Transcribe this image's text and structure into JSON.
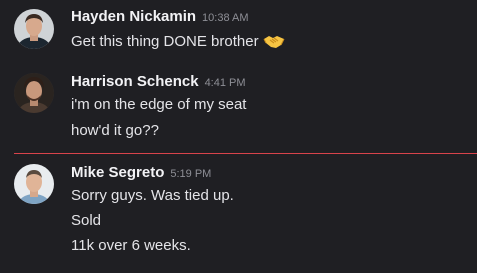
{
  "messages": [
    {
      "author": "Hayden Nickamin",
      "time": "10:38 AM",
      "lines": [
        "Get this thing DONE brother"
      ],
      "emoji": "handshake-icon"
    },
    {
      "author": "Harrison Schenck",
      "time": "4:41 PM",
      "lines": [
        "i'm on the edge of my seat",
        "how'd it go??"
      ]
    },
    {
      "author": "Mike Segreto",
      "time": "5:19 PM",
      "lines": [
        "Sorry guys. Was tied up.",
        "Sold",
        "11k over 6 weeks."
      ]
    }
  ],
  "colors": {
    "background": "#1f1f23",
    "new_messages_divider": "#d8434b",
    "timestamp": "#8e8f96"
  }
}
